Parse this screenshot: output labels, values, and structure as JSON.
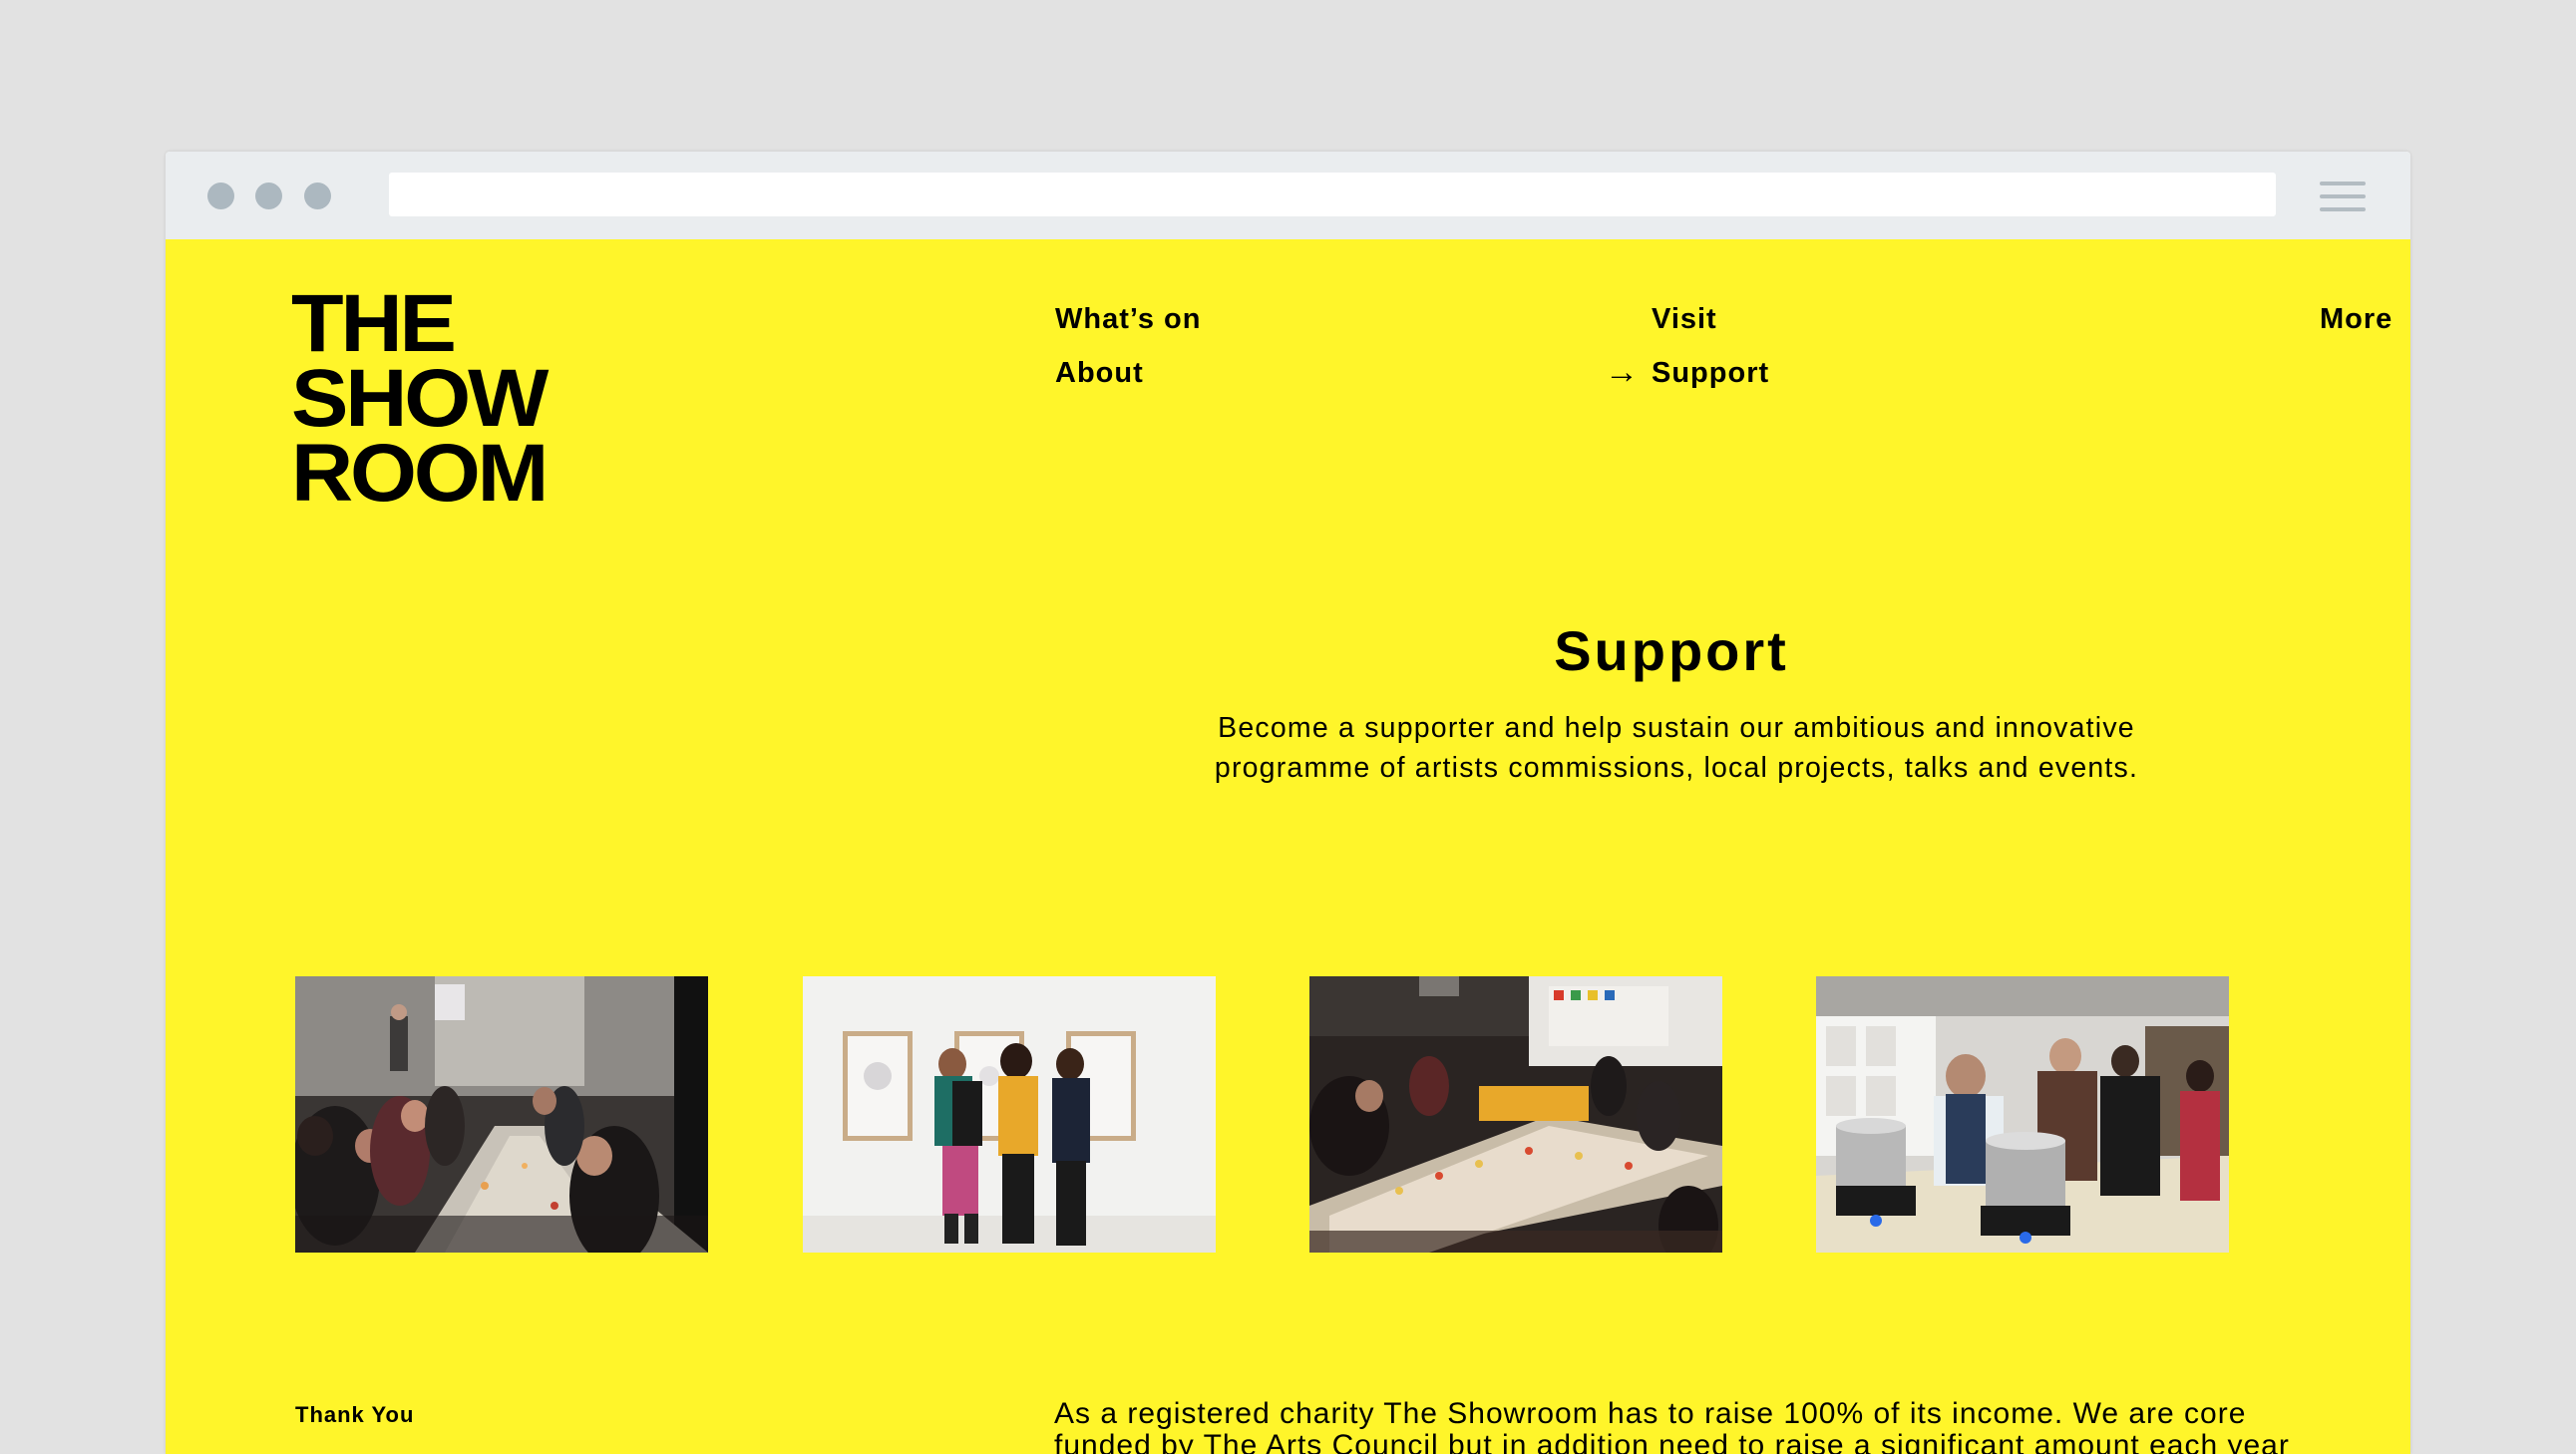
{
  "logo": {
    "line1": "THE",
    "line2": "SHOW",
    "line3": "ROOM"
  },
  "nav": {
    "whats_on": "What’s on",
    "about": "About",
    "visit": "Visit",
    "support": "Support",
    "more": "More",
    "active_marker": "→"
  },
  "page": {
    "title": "Support",
    "intro": "Become a supporter and help sustain our ambitious and innovative programme of artists commissions, local projects, talks and events."
  },
  "photos": [
    "dinner-table-photo",
    "gallery-visitors-photo",
    "banquet-hall-photo",
    "cooking-event-photo"
  ],
  "thank_you": {
    "label": "Thank You",
    "text": "As a registered charity The Showroom has to raise 100% of its income. We are core funded by The Arts Council but in addition need to raise a significant amount each year from trusts, foundations and individuals."
  },
  "colors": {
    "background": "#fff52a",
    "page_backdrop": "#e2e2e2",
    "browser_chrome": "#eaedef"
  }
}
